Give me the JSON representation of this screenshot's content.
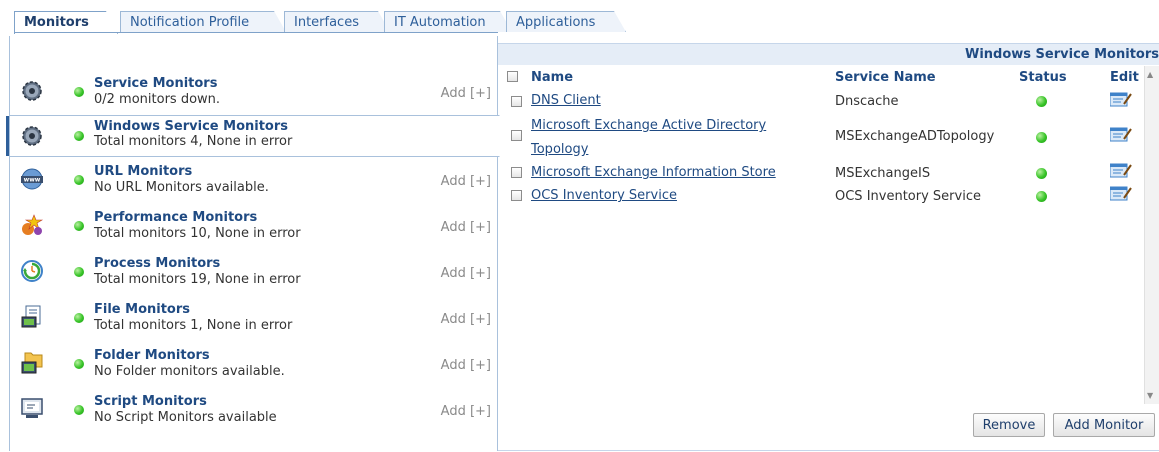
{
  "tabs": [
    {
      "label": "Monitors",
      "active": true
    },
    {
      "label": "Notification Profile",
      "active": false
    },
    {
      "label": "Interfaces",
      "active": false
    },
    {
      "label": "IT Automation",
      "active": false
    },
    {
      "label": "Applications",
      "active": false
    }
  ],
  "add_label": "Add [+]",
  "monitors": [
    {
      "title": "Service Monitors",
      "sub": "0/2 monitors down.",
      "icon": "gear-icon",
      "add": true
    },
    {
      "title": "Windows Service Monitors",
      "sub": "Total monitors 4, None in error",
      "icon": "gear-icon",
      "add": false,
      "selected": true
    },
    {
      "title": "URL Monitors",
      "sub": "No URL Monitors available.",
      "icon": "www-globe-icon",
      "add": true
    },
    {
      "title": "Performance Monitors",
      "sub": "Total monitors 10, None in error",
      "icon": "performance-icon",
      "add": true
    },
    {
      "title": "Process Monitors",
      "sub": "Total monitors 19, None in error",
      "icon": "process-icon",
      "add": true
    },
    {
      "title": "File Monitors",
      "sub": "Total monitors 1, None in error",
      "icon": "file-icon",
      "add": true
    },
    {
      "title": "Folder Monitors",
      "sub": "No Folder monitors available.",
      "icon": "folder-icon",
      "add": true
    },
    {
      "title": "Script Monitors",
      "sub": "No Script Monitors available",
      "icon": "script-icon",
      "add": true
    }
  ],
  "panel": {
    "title": "Windows Service Monitors",
    "columns": {
      "name": "Name",
      "service": "Service Name",
      "status": "Status",
      "edit": "Edit"
    },
    "rows": [
      {
        "name": "DNS Client",
        "service": "Dnscache",
        "status": "up"
      },
      {
        "name_line1": "Microsoft Exchange Active Directory",
        "name_line2": "Topology",
        "service": "MSExchangeADTopology",
        "status": "up"
      },
      {
        "name": "Microsoft Exchange Information Store",
        "service": "MSExchangeIS",
        "status": "up"
      },
      {
        "name": "OCS Inventory Service",
        "service": "OCS Inventory Service",
        "status": "up"
      }
    ],
    "buttons": {
      "remove": "Remove",
      "add": "Add Monitor"
    }
  },
  "colors": {
    "accent": "#1f4a82",
    "status_up": "#38c428",
    "tab_border": "#9db8d6"
  }
}
